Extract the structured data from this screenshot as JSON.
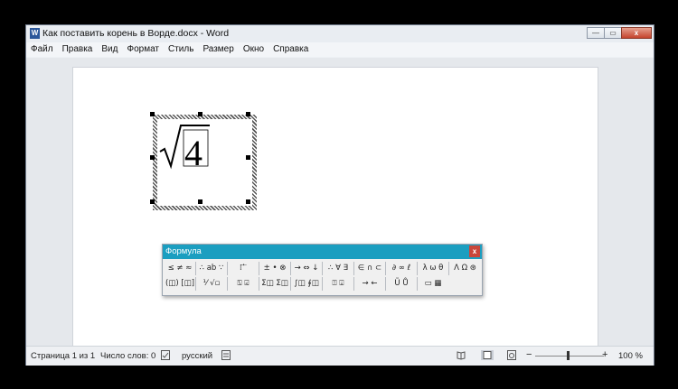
{
  "window": {
    "app_icon_letter": "W",
    "title": "Как поставить корень в Ворде.docx - Word",
    "controls": {
      "minimize": "—",
      "maximize": "▭",
      "close": "x"
    }
  },
  "menu": [
    "Файл",
    "Правка",
    "Вид",
    "Формат",
    "Стиль",
    "Размер",
    "Окно",
    "Справка"
  ],
  "document": {
    "equation_value": "4"
  },
  "formula_toolbar": {
    "title": "Формула",
    "close": "x",
    "row1": [
      "≤ ≠ ≈",
      "∴ ab ∵",
      "⁞ ⃗ ⃖",
      "± • ⊗",
      "→ ⇔ ↓",
      "∴ ∀ ∃",
      "∈ ∩ ⊂",
      "∂ ∞ ℓ",
      "λ ω θ",
      "Λ Ω ⊛"
    ],
    "row2": [
      "(◫) [◫]",
      "⅟ √▫",
      "⍂ ⍃",
      "Σ◫ Σ◫",
      "∫◫ ∮◫",
      "⍐ ⍗",
      "→ ←",
      "Ũ Ů",
      "▭ ▦"
    ]
  },
  "statusbar": {
    "page": "Страница 1 из 1",
    "words": "Число слов: 0",
    "language": "русский",
    "zoom_minus": "−",
    "zoom_plus": "+",
    "zoom": "100 %"
  }
}
